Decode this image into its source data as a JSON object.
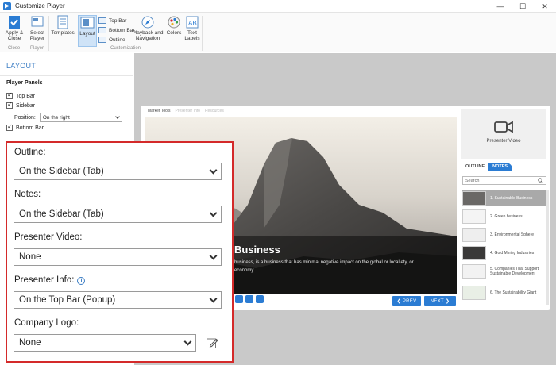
{
  "window": {
    "title": "Customize Player",
    "minimize": "—",
    "maximize": "☐",
    "close": "✕"
  },
  "ribbon": {
    "apply_close": "Apply & Close",
    "select_player": "Select Player",
    "templates": "Templates",
    "layout": "Layout",
    "top_bar": "Top Bar",
    "bottom_bar": "Bottom Bar",
    "outline": "Outline",
    "playback": "Playback and Navigation",
    "colors": "Colors",
    "text_labels": "Text Labels",
    "groups": {
      "close": "Close",
      "player": "Player",
      "customization": "Customization"
    }
  },
  "left_panel": {
    "title": "LAYOUT",
    "section": "Player Panels",
    "top_bar": "Top Bar",
    "sidebar": "Sidebar",
    "position_label": "Position:",
    "position_value": "On the right",
    "bottom_bar": "Bottom Bar"
  },
  "settings": {
    "outline_label": "Outline:",
    "outline_value": "On the Sidebar (Tab)",
    "notes_label": "Notes:",
    "notes_value": "On the Sidebar (Tab)",
    "video_label": "Presenter Video:",
    "video_value": "None",
    "info_label": "Presenter Info:",
    "info_value": "On the Top Bar (Popup)",
    "logo_label": "Company Logo:",
    "logo_value": "None"
  },
  "preview": {
    "tabs": [
      "Marker Tools",
      "Presenter Info",
      "Resources"
    ],
    "slide_title": "Business",
    "slide_text": "business, is a business that has minimal negative impact on the global or local ety, or economy.",
    "prev": "❮ PREV",
    "next": "NEXT ❯",
    "presenter_video": "Presenter Video",
    "tab_outline": "OUTLINE",
    "tab_notes": "NOTES",
    "search": "Search",
    "outline_items": [
      "1. Sustainable Business",
      "2. Green business",
      "3. Environmental Sphere",
      "4. Gold Mining Industries",
      "5. Companies That Support Sustainable Development",
      "6. The Sustainability Giant"
    ]
  },
  "colors": {
    "accent": "#2b7cd3",
    "highlight_border": "#d42a2a",
    "stage_bg": "#c9c9c9"
  }
}
